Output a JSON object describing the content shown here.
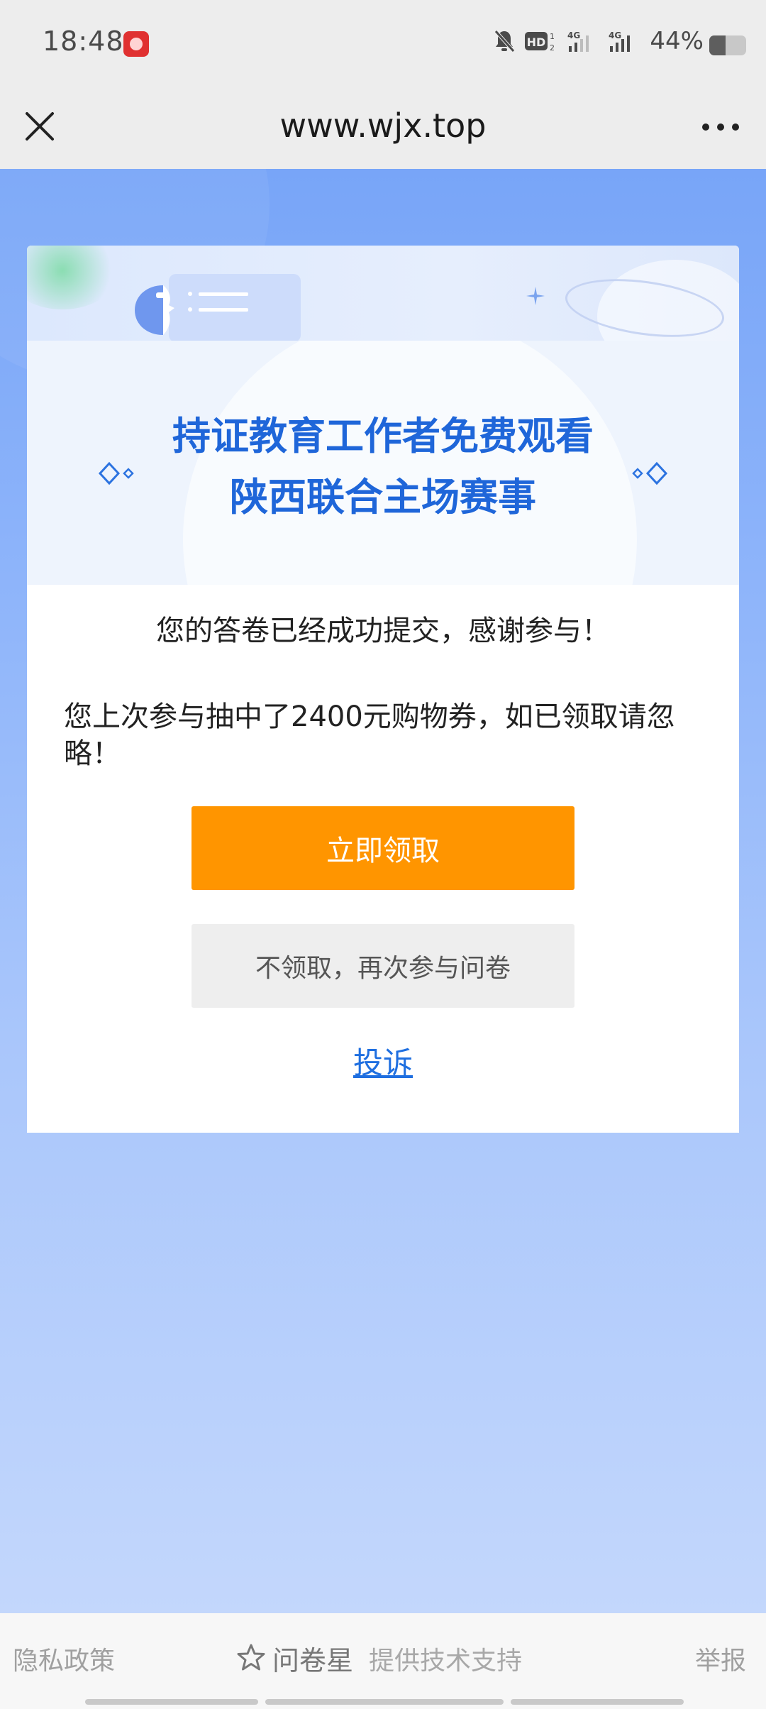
{
  "status_bar": {
    "time": "18:48",
    "battery_text": "44%",
    "battery_level": 0.44,
    "network_1": "4G",
    "network_2": "4G",
    "hd_label": "HD",
    "icons": [
      "app-notification-icon",
      "mute-icon",
      "hd-call-icon",
      "signal-4g-icon",
      "signal-4g-icon",
      "battery-icon"
    ]
  },
  "browser": {
    "url": "www.wjx.top",
    "close_icon": "close-icon",
    "more_icon": "more-icon"
  },
  "card": {
    "title_line1": "持证教育工作者免费观看",
    "title_line2": "陕西联合主场赛事",
    "thanks": "您的答卷已经成功提交，感谢参与！",
    "prize_message": "您上次参与抽中了2400元购物券，如已领取请忽略！",
    "claim_button": "立即领取",
    "decline_button": "不领取，再次参与问卷",
    "complain_link": "投诉"
  },
  "footer": {
    "privacy": "隐私政策",
    "brand": "问卷星",
    "support": "提供技术支持",
    "report": "举报"
  },
  "colors": {
    "title_blue": "#1f66d9",
    "claim_orange": "#ff9500",
    "link_blue": "#1f6fe0",
    "page_gradient_top": "#78a5f8",
    "page_gradient_bottom": "#c3d7fc"
  }
}
